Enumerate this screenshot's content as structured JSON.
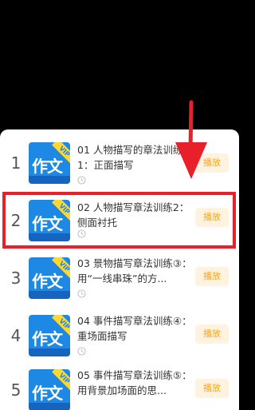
{
  "lessons": [
    {
      "number": "1",
      "cover_text": "作文",
      "vip": "VIP",
      "title": "01 人物描写的章法训练1：正面描写",
      "play_label": "播放"
    },
    {
      "number": "2",
      "cover_text": "作文",
      "vip": "VIP",
      "title": "02 人物描写章法训练2：侧面衬托",
      "play_label": "播放"
    },
    {
      "number": "3",
      "cover_text": "作文",
      "vip": "VIP",
      "title": "03 景物描写章法训练③：用“一线串珠”的方...",
      "play_label": "播放"
    },
    {
      "number": "4",
      "cover_text": "作文",
      "vip": "VIP",
      "title": "04 事件描写章法训练④：重场面描写",
      "play_label": "播放"
    },
    {
      "number": "5",
      "cover_text": "作文",
      "vip": "VIP",
      "title": "05 事件描写章法训练⑤：用背景加场面的思...",
      "play_label": "播放"
    }
  ],
  "colors": {
    "highlight": "#e8202a",
    "accent": "#f5a623",
    "cover": "#1e88e5"
  },
  "icons": {
    "clock": "clock-icon",
    "annotation_arrow": "arrow-down-icon"
  }
}
